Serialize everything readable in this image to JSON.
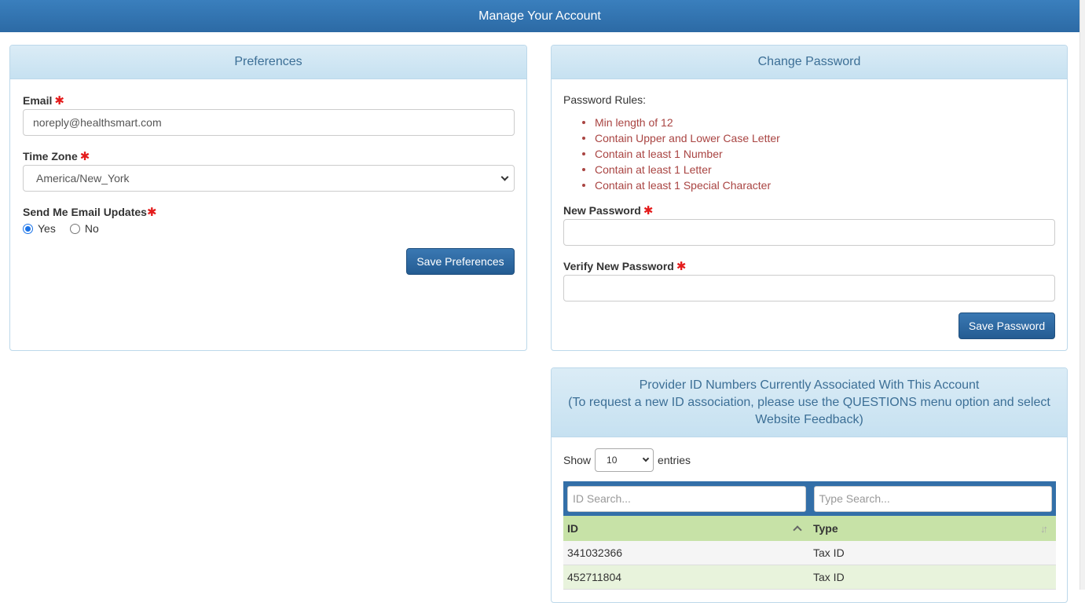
{
  "header": {
    "title": "Manage Your Account"
  },
  "preferences": {
    "heading": "Preferences",
    "email_label": "Email",
    "email_value": "noreply@healthsmart.com",
    "timezone_label": "Time Zone",
    "timezone_value": "America/New_York",
    "updates_label": "Send Me Email Updates",
    "yes_label": "Yes",
    "no_label": "No",
    "updates_selected": "Yes",
    "save_label": "Save Preferences"
  },
  "password": {
    "heading": "Change Password",
    "rules_title": "Password Rules:",
    "rules": [
      "Min length of 12",
      "Contain Upper and Lower Case Letter",
      "Contain at least 1 Number",
      "Contain at least 1 Letter",
      "Contain at least 1 Special Character"
    ],
    "new_label": "New Password",
    "verify_label": "Verify New Password",
    "save_label": "Save Password"
  },
  "provider": {
    "heading_line1": "Provider ID Numbers Currently Associated With This Account",
    "heading_line2": "(To request a new ID association, please use the QUESTIONS menu option and select Website Feedback)",
    "show_label": "Show",
    "entries_value": "10",
    "entries_label": "entries",
    "id_search_placeholder": "ID Search...",
    "type_search_placeholder": "Type Search...",
    "columns": [
      "ID",
      "Type"
    ],
    "rows": [
      {
        "id": "341032366",
        "type": "Tax ID"
      },
      {
        "id": "452711804",
        "type": "Tax ID"
      }
    ]
  },
  "colors": {
    "header_blue": "#2f6fab",
    "required": "#e41c1c",
    "rule_text": "#a94442",
    "table_header": "#c7e2a7"
  }
}
